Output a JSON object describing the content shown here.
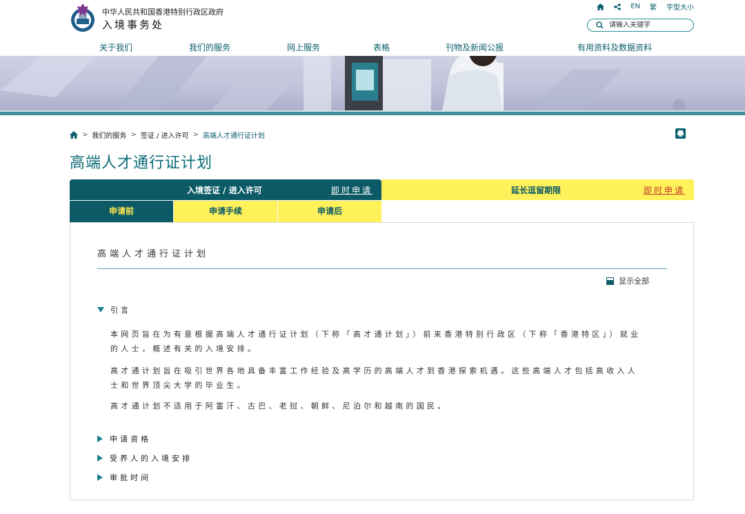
{
  "header": {
    "org_name": "中华人民共和国香港特别行政区政府",
    "dept_name": "入境事务处",
    "util": {
      "lang_en": "EN",
      "lang_tc": "繁",
      "font_size": "字型大小"
    },
    "search_placeholder": "请输入关键字"
  },
  "nav": [
    "关于我们",
    "我们的服务",
    "网上服务",
    "表格",
    "刊物及新闻公报",
    "有用资料及数据资料"
  ],
  "breadcrumb": [
    "我们的服务",
    "签证 / 进入许可",
    "高端人才通行证计划"
  ],
  "page_title": "高端人才通行证计划",
  "tabs": {
    "entry": {
      "label": "入境签证 / 进入许可",
      "apply": "即时申请"
    },
    "extend": {
      "label": "延长逗留期限",
      "apply": "即时申请"
    },
    "subtabs": [
      "申请前",
      "申请手续",
      "申请后"
    ]
  },
  "content": {
    "heading": "高端人才通行证计划",
    "show_all": "显示全部",
    "intro_title": "引言",
    "paragraphs": [
      "本网页旨在为有意根据高端人才通行证计划（下称「高才通计划」）前来香港特别行政区（下称「香港特区」）就业的人士，概述有关的入境安排。",
      "高才通计划旨在吸引世界各地具备丰富工作经验及高学历的高端人才到香港探索机遇。这些高端人才包括高收入人士和世界顶尖大学的毕业生。",
      "高才通计划不适用于阿富汗、古巴、老挝、朝鲜、尼泊尔和越南的国民。"
    ],
    "sections": [
      "申请资格",
      "受养人的入境安排",
      "审批时间"
    ]
  },
  "colors": {
    "teal": "#0b5a66",
    "yellow": "#fff159",
    "link": "#0b5f6e",
    "apply_red": "#c0392b"
  }
}
